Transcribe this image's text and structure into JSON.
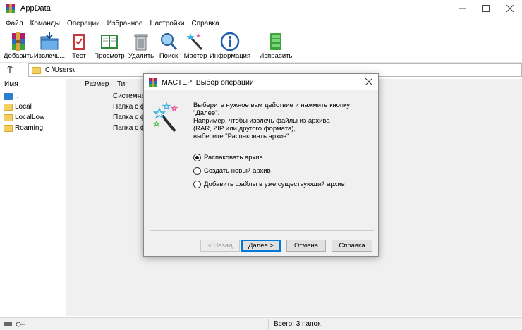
{
  "window": {
    "title": "AppData"
  },
  "menu": [
    "Файл",
    "Команды",
    "Операции",
    "Избранное",
    "Настройки",
    "Справка"
  ],
  "toolbar": [
    {
      "label": "Добавить",
      "icon": "rar-archive-icon"
    },
    {
      "label": "Извлечь...",
      "icon": "folder-extract-icon"
    },
    {
      "label": "Тест",
      "icon": "test-clipboard-icon"
    },
    {
      "label": "Просмотр",
      "icon": "book-view-icon"
    },
    {
      "label": "Удалить",
      "icon": "trash-icon"
    },
    {
      "label": "Поиск",
      "icon": "magnifier-icon"
    },
    {
      "label": "Мастер",
      "icon": "wizard-wand-icon"
    },
    {
      "label": "Информация",
      "icon": "info-icon"
    },
    {
      "label": "Исправить",
      "icon": "repair-kit-icon"
    }
  ],
  "address": {
    "path": "C:\\Users\\"
  },
  "columns": {
    "name": "Имя",
    "size": "Размер",
    "type": "Тип"
  },
  "files": [
    {
      "name": "..",
      "type": "Системная"
    },
    {
      "name": "Local",
      "type": "Папка с ф"
    },
    {
      "name": "LocalLow",
      "type": "Папка с ф"
    },
    {
      "name": "Roaming",
      "type": "Папка с ф"
    }
  ],
  "status": {
    "text": "Всего: 3 папок"
  },
  "dialog": {
    "title": "МАСТЕР:  Выбор операции",
    "instruction": "Выберите нужное вам действие и нажмите кнопку \"Далее\".",
    "example": "Например, чтобы извлечь файлы из архива\n(RAR, ZIP или другого формата),\nвыберите \"Распаковать архив\".",
    "options": [
      "Распаковать архив",
      "Создать новый архив",
      "Добавить файлы в уже существующий архив"
    ],
    "selected": 0,
    "buttons": {
      "back": "< Назад",
      "next": "Далее >",
      "cancel": "Отмена",
      "help": "Справка"
    }
  },
  "colors": {
    "folder": "#f3cf62",
    "accent": "#0078d7"
  }
}
